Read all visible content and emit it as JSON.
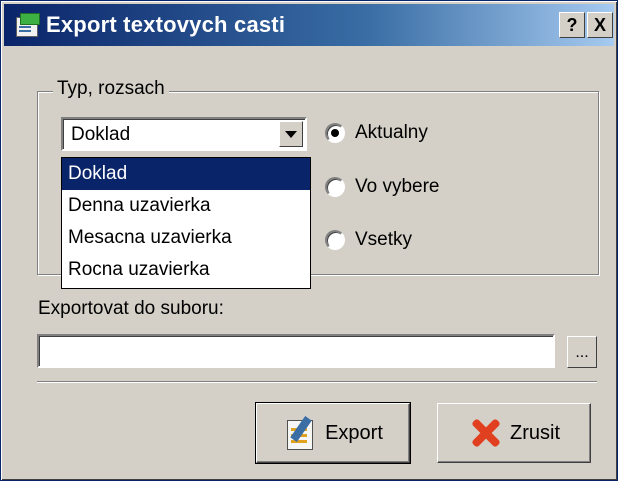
{
  "window": {
    "title": "Export textovych casti",
    "help_label": "?",
    "close_label": "X"
  },
  "group": {
    "label": "Typ, rozsach",
    "combo_value": "Doklad",
    "dropdown_options": [
      "Doklad",
      "Denna uzavierka",
      "Mesacna uzavierka",
      "Rocna uzavierka"
    ],
    "selected_option": "Doklad",
    "radios": [
      {
        "label": "Aktualny",
        "checked": true
      },
      {
        "label": "Vo vybere",
        "checked": false
      },
      {
        "label": "Vsetky",
        "checked": false
      }
    ]
  },
  "file": {
    "label": "Exportovat do suboru:",
    "value": "",
    "browse_label": "..."
  },
  "buttons": {
    "export_label": "Export",
    "cancel_label": "Zrusit"
  },
  "icons": {
    "app": "app-icon",
    "export": "export-icon",
    "cancel": "cancel-x-icon",
    "dropdown": "chevron-down-icon"
  }
}
